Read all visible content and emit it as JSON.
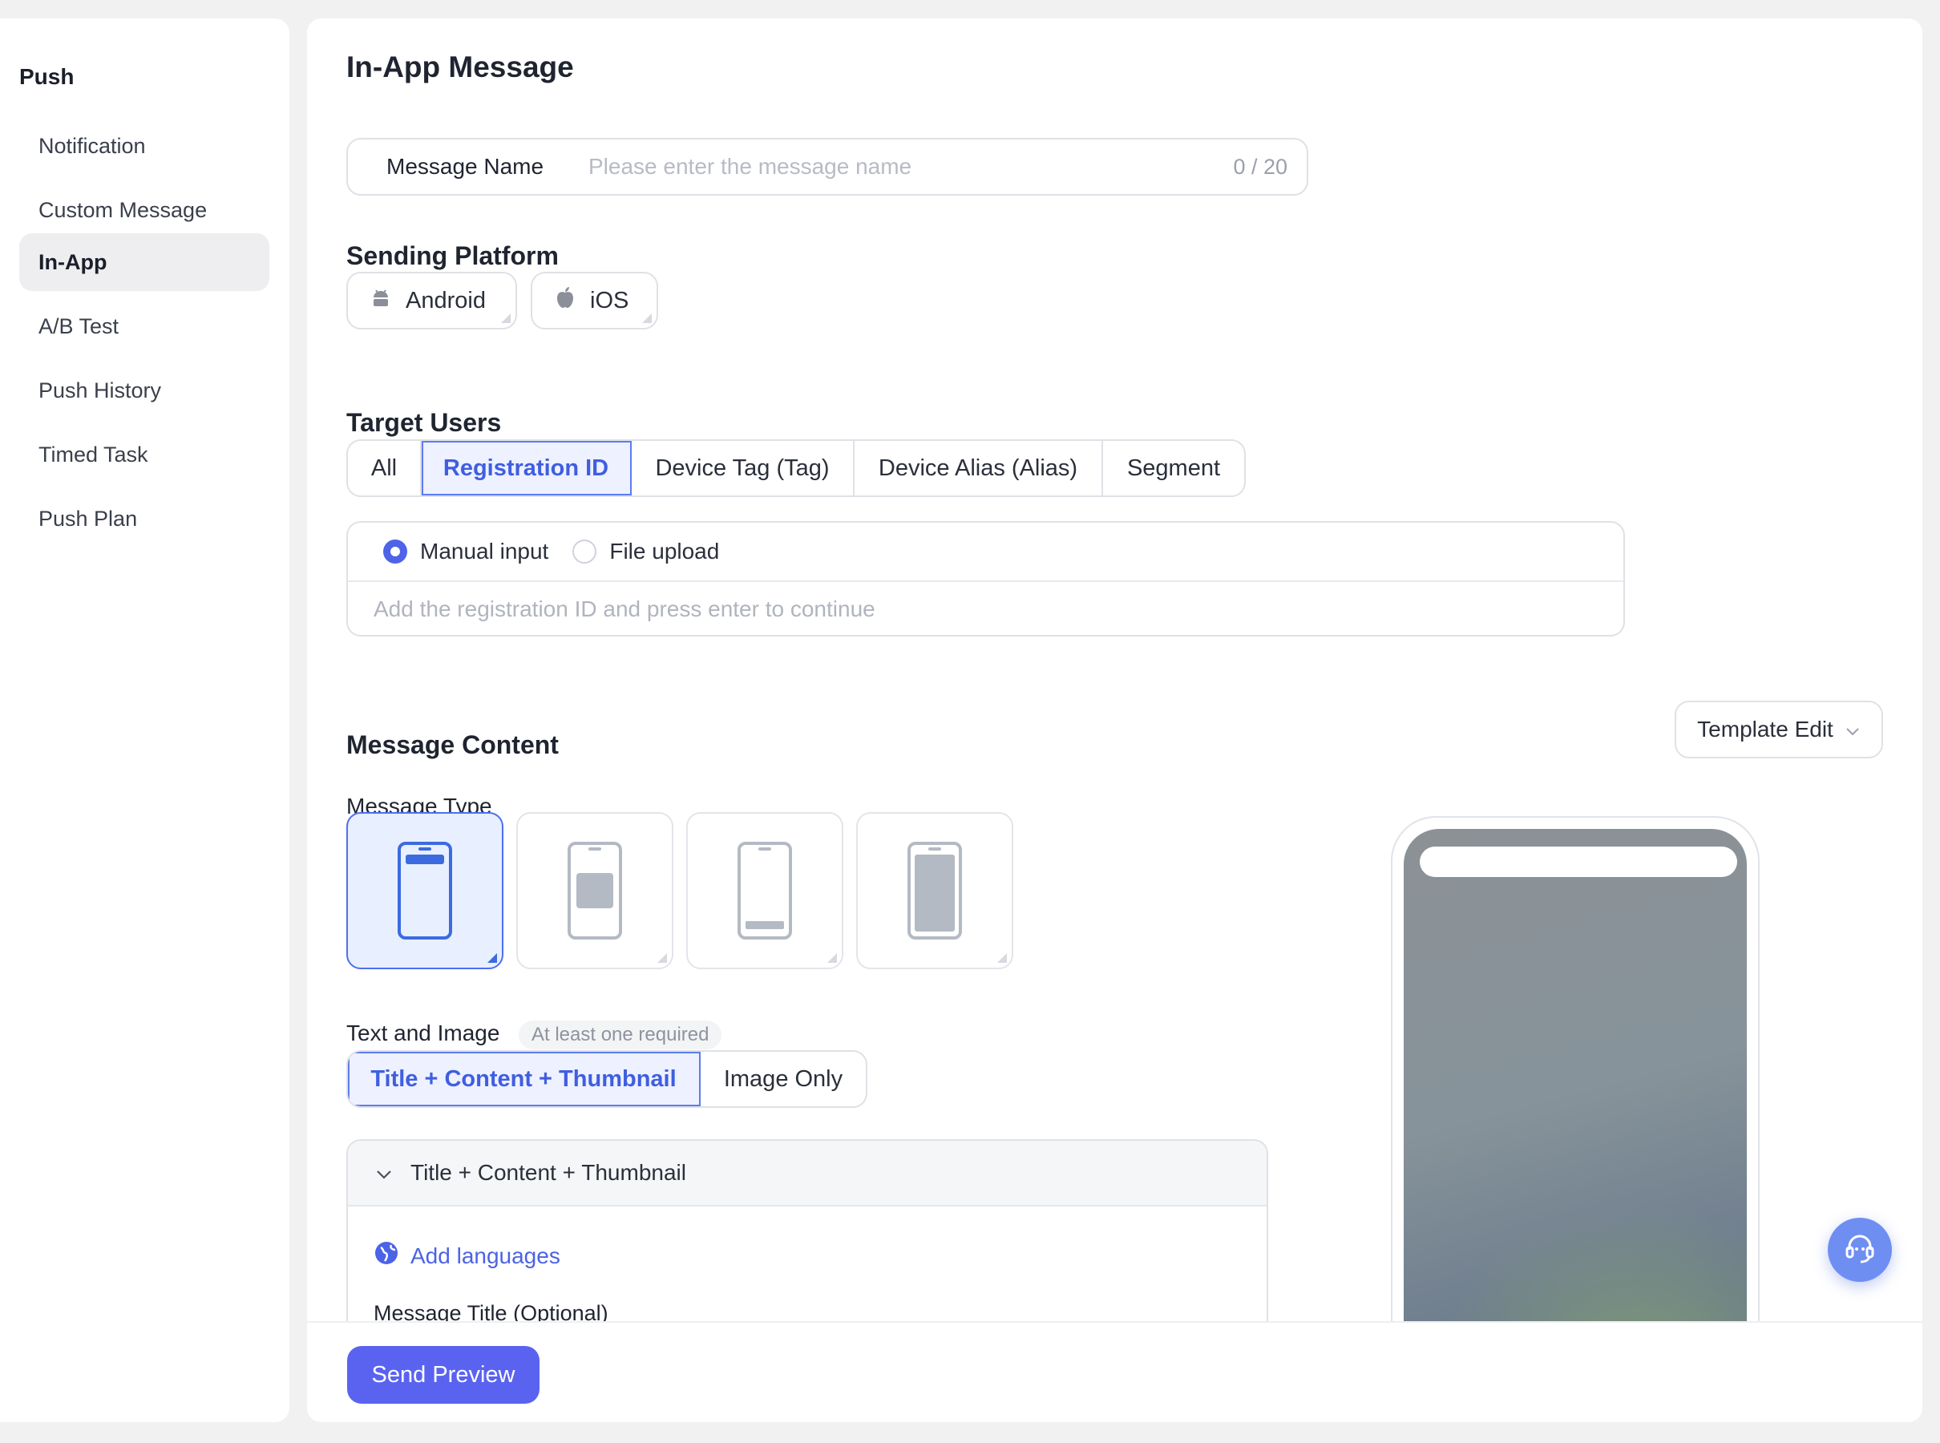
{
  "sidebar": {
    "title": "Push",
    "items": [
      {
        "label": "Notification"
      },
      {
        "label": "Custom Message"
      },
      {
        "label": "In-App",
        "active": true
      },
      {
        "label": "A/B Test"
      },
      {
        "label": "Push History"
      },
      {
        "label": "Timed Task"
      },
      {
        "label": "Push Plan"
      }
    ]
  },
  "page": {
    "title": "In-App Message"
  },
  "message_name": {
    "label": "Message Name",
    "placeholder": "Please enter the message name",
    "value": "",
    "counter": "0 / 20"
  },
  "sending_platform": {
    "heading": "Sending Platform",
    "options": [
      {
        "label": "Android",
        "icon": "android-icon"
      },
      {
        "label": "iOS",
        "icon": "apple-icon"
      }
    ]
  },
  "target_users": {
    "heading": "Target Users",
    "tabs": [
      {
        "label": "All"
      },
      {
        "label": "Registration ID",
        "active": true
      },
      {
        "label": "Device Tag (Tag)"
      },
      {
        "label": "Device Alias (Alias)"
      },
      {
        "label": "Segment"
      }
    ],
    "input_modes": [
      {
        "label": "Manual input",
        "selected": true
      },
      {
        "label": "File upload",
        "selected": false
      }
    ],
    "registration_placeholder": "Add the registration ID and press enter to continue"
  },
  "message_content": {
    "heading": "Message Content",
    "template_edit_label": "Template Edit",
    "message_type_label": "Message Type",
    "message_types": [
      {
        "name": "banner-top",
        "selected": true
      },
      {
        "name": "modal-center",
        "selected": false
      },
      {
        "name": "banner-bottom",
        "selected": false
      },
      {
        "name": "fullscreen",
        "selected": false
      }
    ],
    "text_image_label": "Text and Image",
    "text_image_hint": "At least one required",
    "text_image_tabs": [
      {
        "label": "Title + Content + Thumbnail",
        "active": true
      },
      {
        "label": "Image Only"
      }
    ],
    "panel": {
      "header": "Title + Content + Thumbnail",
      "add_languages": "Add languages",
      "field_label": "Message Title (Optional)"
    }
  },
  "footer": {
    "send_preview_label": "Send Preview"
  },
  "colors": {
    "accent": "#5a63f0",
    "active_tab_text": "#3f5ee0",
    "active_tab_bg": "#eef1ff"
  }
}
